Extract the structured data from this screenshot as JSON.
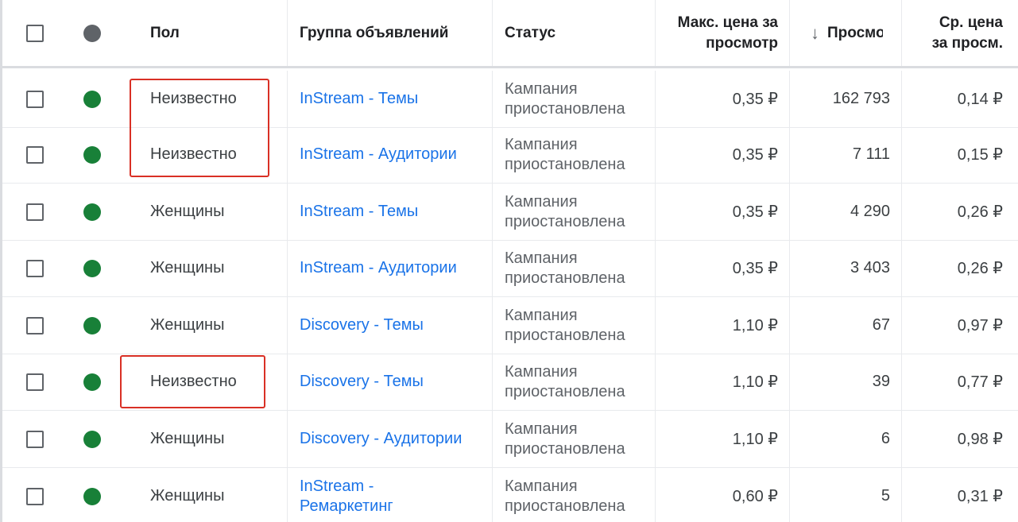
{
  "header": {
    "gender": "Пол",
    "ad_group": "Группа объявлений",
    "status": "Статус",
    "max_cpv_line1": "Макс. цена за",
    "max_cpv_line2": "просмотр",
    "sort_arrow": "↓",
    "views": "Просмотры",
    "avg_cpv_line1": "Ср. цена",
    "avg_cpv_line2": "за просм."
  },
  "rows": [
    {
      "gender": "Неизвестно",
      "ad_group": "InStream - Темы",
      "status_line1": "Кампания",
      "status_line2": "приостановлена",
      "max_cpv": "0,35 ₽",
      "views": "162 793",
      "avg_cpv": "0,14 ₽"
    },
    {
      "gender": "Неизвестно",
      "ad_group": "InStream - Аудитории",
      "status_line1": "Кампания",
      "status_line2": "приостановлена",
      "max_cpv": "0,35 ₽",
      "views": "7 111",
      "avg_cpv": "0,15 ₽"
    },
    {
      "gender": "Женщины",
      "ad_group": "InStream - Темы",
      "status_line1": "Кампания",
      "status_line2": "приостановлена",
      "max_cpv": "0,35 ₽",
      "views": "4 290",
      "avg_cpv": "0,26 ₽"
    },
    {
      "gender": "Женщины",
      "ad_group": "InStream - Аудитории",
      "status_line1": "Кампания",
      "status_line2": "приостановлена",
      "max_cpv": "0,35 ₽",
      "views": "3 403",
      "avg_cpv": "0,26 ₽"
    },
    {
      "gender": "Женщины",
      "ad_group": "Discovery - Темы",
      "status_line1": "Кампания",
      "status_line2": "приостановлена",
      "max_cpv": "1,10 ₽",
      "views": "67",
      "avg_cpv": "0,97 ₽"
    },
    {
      "gender": "Неизвестно",
      "ad_group": "Discovery - Темы",
      "status_line1": "Кампания",
      "status_line2": "приостановлена",
      "max_cpv": "1,10 ₽",
      "views": "39",
      "avg_cpv": "0,77 ₽"
    },
    {
      "gender": "Женщины",
      "ad_group": "Discovery - Аудитории",
      "status_line1": "Кампания",
      "status_line2": "приостановлена",
      "max_cpv": "1,10 ₽",
      "views": "6",
      "avg_cpv": "0,98 ₽"
    },
    {
      "gender": "Женщины",
      "ad_group_line1": "InStream -",
      "ad_group_line2": "Ремаркетинг",
      "status_line1": "Кампания",
      "status_line2": "приостановлена",
      "max_cpv": "0,60 ₽",
      "views": "5",
      "avg_cpv": "0,31 ₽"
    }
  ],
  "colors": {
    "link": "#1a73e8",
    "status_enabled": "#188038",
    "highlight": "#d93025"
  },
  "icons": {
    "checkbox": "checkbox-icon",
    "status_dot": "status-dot-icon",
    "sort": "arrow-down-icon"
  }
}
